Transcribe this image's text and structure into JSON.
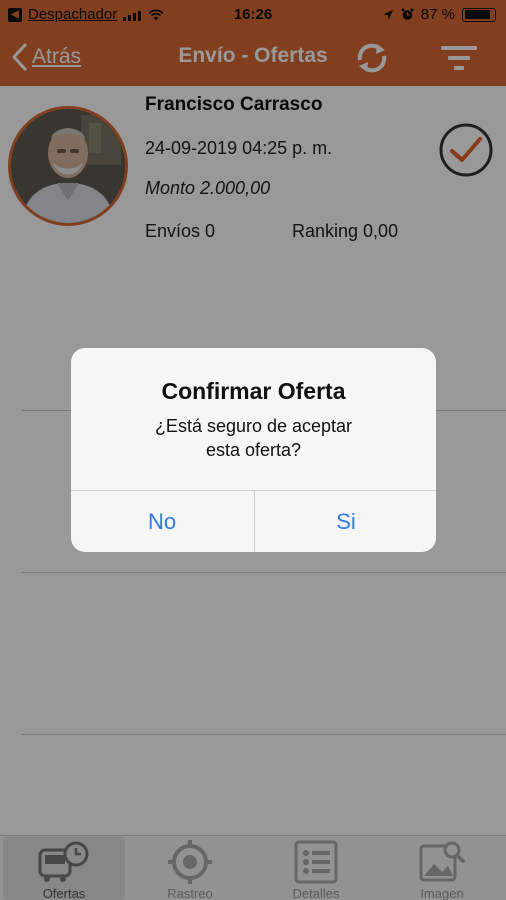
{
  "status_bar": {
    "back_app_label": "Despachador",
    "time": "16:26",
    "battery_text": "87 %",
    "battery_level": 0.87
  },
  "nav": {
    "back_label": "Atrás",
    "title": "Envío - Ofertas"
  },
  "offer": {
    "name": "Francisco Carrasco",
    "date": "24-09-2019 04:25 p. m.",
    "amount": "Monto 2.000,00",
    "shipments": "Envíos 0",
    "ranking": "Ranking 0,00"
  },
  "dialog": {
    "title": "Confirmar Oferta",
    "message_line1": "¿Está seguro de aceptar",
    "message_line2": "esta oferta?",
    "no_label": "No",
    "yes_label": "Si"
  },
  "tabs": [
    {
      "label": "Ofertas",
      "icon": "bus-clock-icon",
      "active": true
    },
    {
      "label": "Rastreo",
      "icon": "crosshair-icon",
      "active": false
    },
    {
      "label": "Detalles",
      "icon": "list-icon",
      "active": false
    },
    {
      "label": "Imagen",
      "icon": "image-search-icon",
      "active": false
    }
  ],
  "colors": {
    "accent": "#d86a35",
    "ios_blue": "#2f7ae5"
  }
}
